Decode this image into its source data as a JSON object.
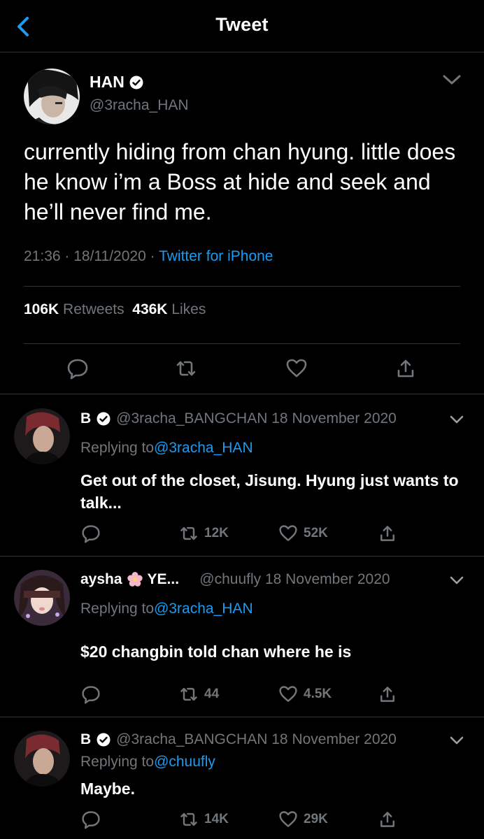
{
  "header": {
    "title": "Tweet"
  },
  "main_tweet": {
    "name": "HAN",
    "handle": "@3racha_HAN",
    "text": "currently hiding from chan hyung. little does he know i’m a Boss at hide and seek and he’ll never find me.",
    "time": "21:36",
    "date": "18/11/2020",
    "source": "Twitter for iPhone",
    "retweets_count": "106K",
    "retweets_label": "Retweets",
    "likes_count": "436K",
    "likes_label": "Likes"
  },
  "replies": [
    {
      "name": "B",
      "handle": "@3racha_BANGCHAN",
      "date": "18 November 2020",
      "replying_label": "Replying to",
      "replying_to": "@3racha_HAN",
      "text": "Get out of the closet, Jisung. Hyung just wants to talk...",
      "retweets": "12K",
      "likes": "52K"
    },
    {
      "name": "aysha",
      "name_suffix": "YE...",
      "handle": "@chuufly",
      "date": "18 November 2020",
      "replying_label": "Replying to",
      "replying_to": "@3racha_HAN",
      "text": "$20 changbin told chan where he is",
      "retweets": "44",
      "likes": "4.5K"
    },
    {
      "name": "B",
      "handle": "@3racha_BANGCHAN",
      "date": "18 November 2020",
      "replying_label": "Replying to",
      "replying_to": "@chuufly",
      "text": "Maybe.",
      "retweets": "14K",
      "likes": "29K"
    }
  ],
  "icons": {
    "back": "chevron-left-icon",
    "verified": "verified-badge-icon",
    "more": "chevron-down-icon",
    "reply": "reply-bubble-icon",
    "retweet": "retweet-icon",
    "like": "heart-icon",
    "share": "share-icon",
    "emoji": "cherry-blossom-icon"
  },
  "colors": {
    "background": "#000000",
    "accent": "#1d9bf0",
    "muted": "#71767b",
    "divider": "#2f3336"
  }
}
